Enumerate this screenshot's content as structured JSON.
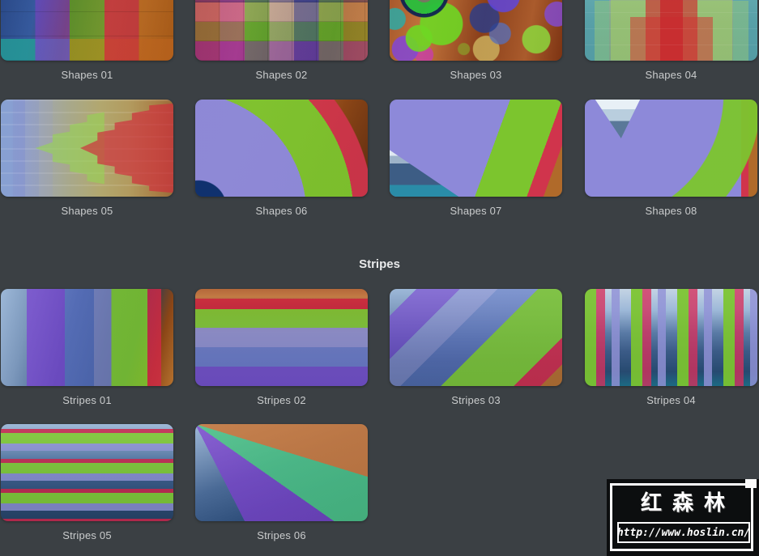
{
  "colors": {
    "background": "#3b4044",
    "label_text": "#cacccd",
    "header_text": "#e9eaeb",
    "accent_purple": "#8d89d9",
    "accent_green": "#7cc52e",
    "accent_red": "#d0344c",
    "watermark_bg": "#0c0e0f"
  },
  "sections": {
    "shapes": {
      "items": [
        {
          "label": "Shapes 01"
        },
        {
          "label": "Shapes 02"
        },
        {
          "label": "Shapes 03"
        },
        {
          "label": "Shapes 04"
        },
        {
          "label": "Shapes 05"
        },
        {
          "label": "Shapes 06"
        },
        {
          "label": "Shapes 07"
        },
        {
          "label": "Shapes 08"
        }
      ]
    },
    "stripes": {
      "header": "Stripes",
      "items": [
        {
          "label": "Stripes 01"
        },
        {
          "label": "Stripes 02"
        },
        {
          "label": "Stripes 03"
        },
        {
          "label": "Stripes 04"
        },
        {
          "label": "Stripes 05"
        },
        {
          "label": "Stripes 06"
        }
      ]
    }
  },
  "watermark": {
    "title": "红森林",
    "url": "http://www.hoslin.cn/"
  }
}
